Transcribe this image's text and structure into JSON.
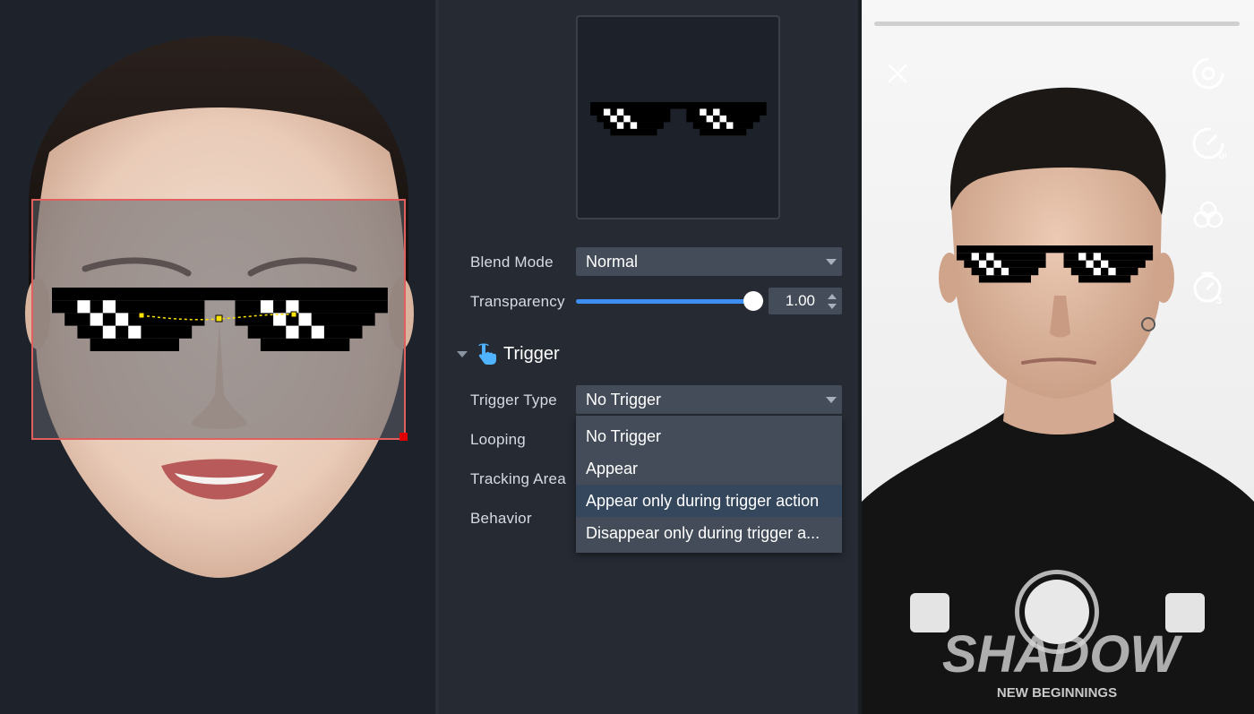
{
  "properties": {
    "blend_mode": {
      "label": "Blend Mode",
      "value": "Normal"
    },
    "transparency": {
      "label": "Transparency",
      "value": "1.00",
      "level": 1.0
    },
    "trigger_section": {
      "title": "Trigger"
    },
    "trigger_type": {
      "label": "Trigger Type",
      "value": "No Trigger"
    },
    "looping": {
      "label": "Looping"
    },
    "tracking_area": {
      "label": "Tracking Area"
    },
    "behavior": {
      "label": "Behavior"
    },
    "dropdown_options": [
      "No Trigger",
      "Appear",
      "Appear only during trigger action",
      "Disappear only during trigger a..."
    ],
    "highlighted_option": "Appear only during trigger action"
  },
  "preview": {
    "shirt_text": "SHADOW",
    "shirt_subtext": "NEW BEGINNINGS",
    "timer_badge": "3",
    "speed_badge": "off"
  },
  "icons": {
    "trigger": "pointing-hand-icon",
    "close": "close-icon",
    "flip": "flip-camera-icon",
    "speed": "speed-icon",
    "beauty": "beauty-filter-icon",
    "timer": "timer-icon"
  },
  "colors": {
    "accent": "#3d8ff4",
    "panel": "#262b33",
    "dropdown": "#434c58",
    "highlight": "#34475c",
    "bounding_box": "#e06060",
    "anchor": "#ffe400"
  }
}
